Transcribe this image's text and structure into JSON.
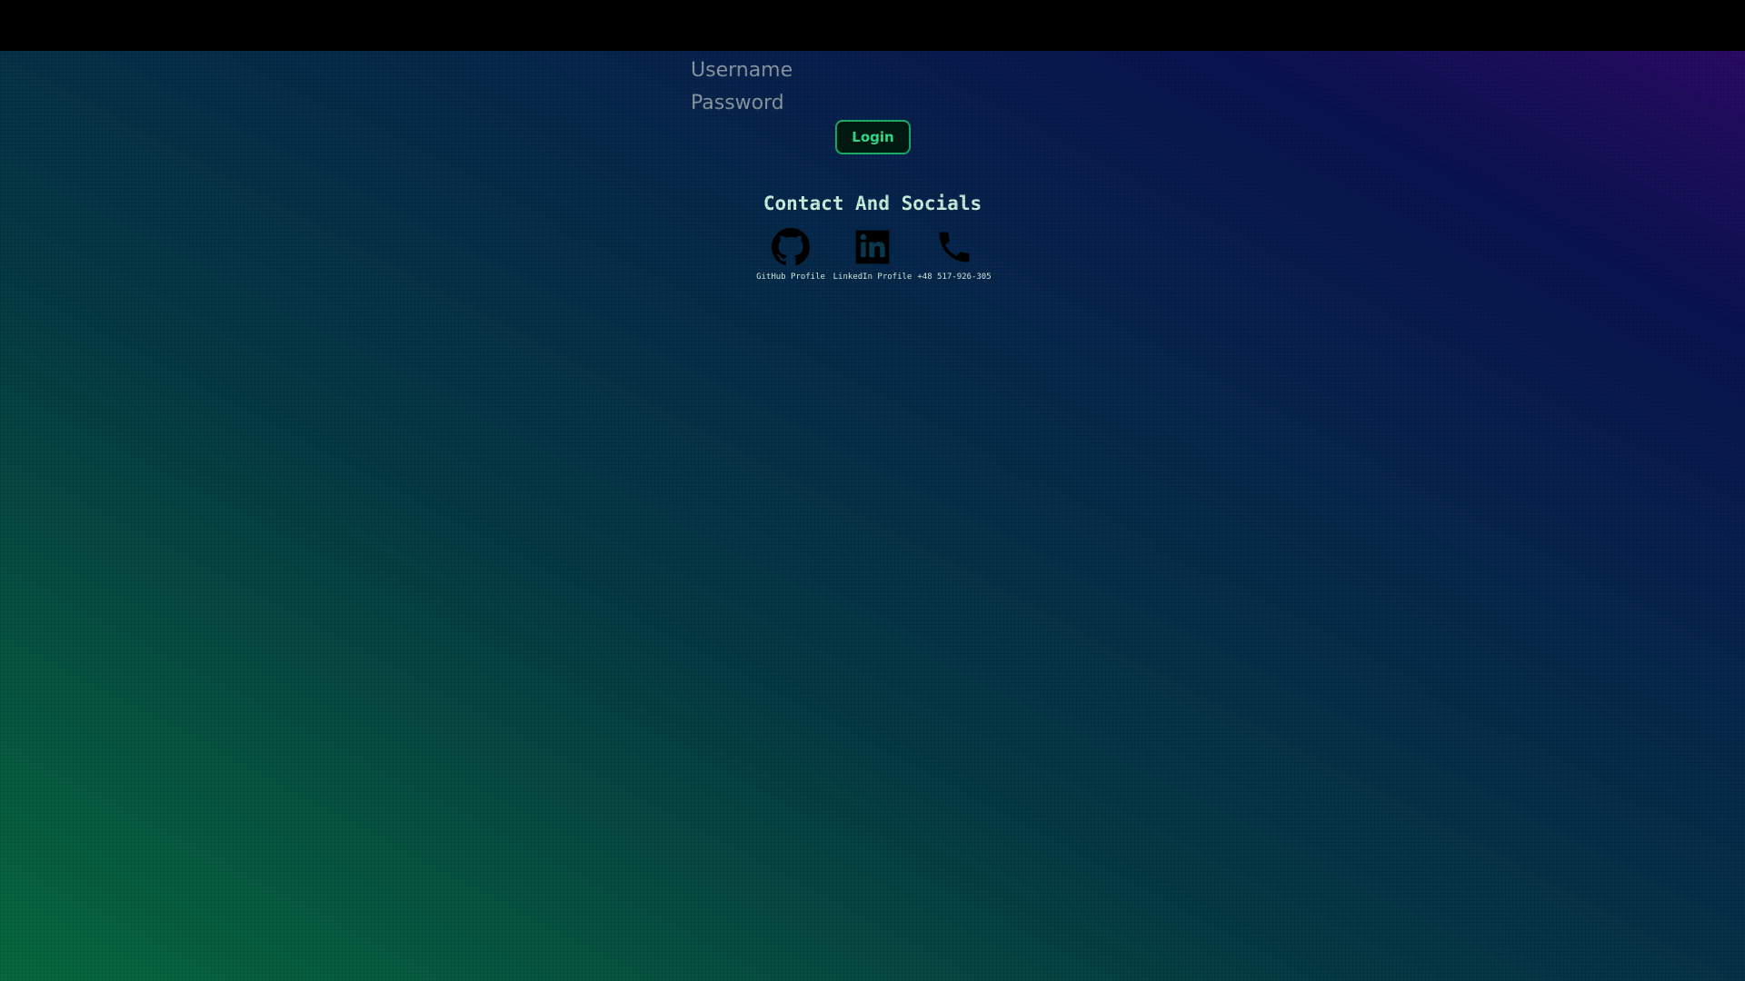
{
  "login_form": {
    "username_placeholder": "Username",
    "username_value": "",
    "password_placeholder": "Password",
    "password_value": "",
    "login_label": "Login"
  },
  "contact": {
    "title": "Contact And Socials",
    "items": [
      {
        "icon": "github-icon",
        "label": "GitHub Profile"
      },
      {
        "icon": "linkedin-icon",
        "label": "LinkedIn Profile"
      },
      {
        "icon": "phone-icon",
        "label": "+48 517-926-305"
      }
    ]
  },
  "colors": {
    "accent": "#35e08c",
    "button_border": "#1fae6a",
    "title_text": "#c9f3de",
    "icon_fill": "#000000"
  }
}
